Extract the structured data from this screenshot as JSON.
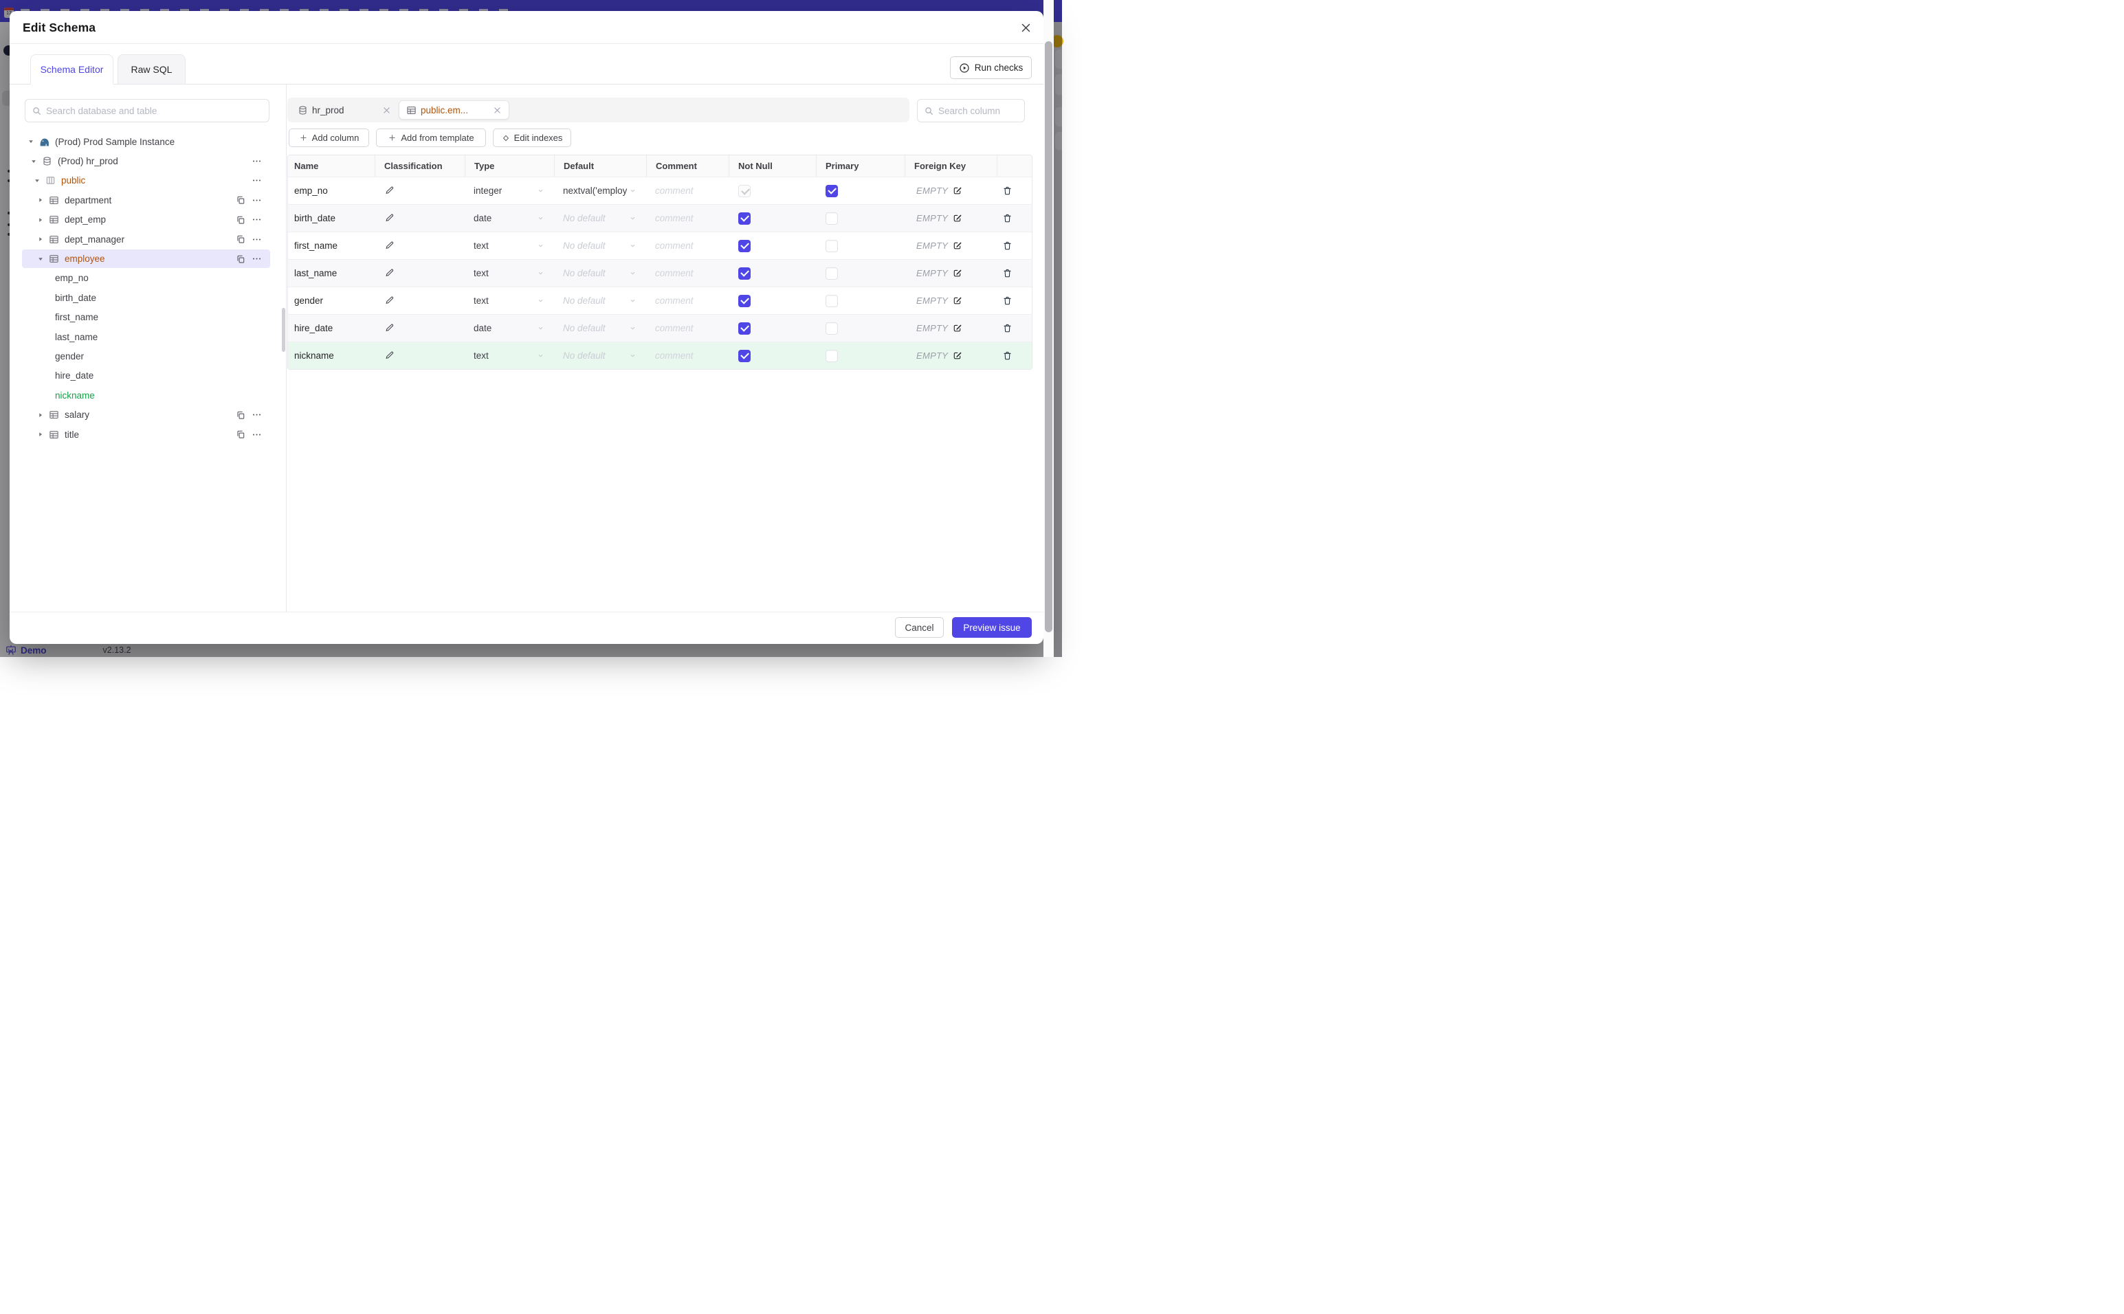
{
  "background": {
    "top_bar_color": "#4f46e5",
    "demo_label": "Demo",
    "version": "v2.13.2"
  },
  "modal": {
    "title": "Edit Schema",
    "tabs": [
      {
        "label": "Schema Editor",
        "active": true
      },
      {
        "label": "Raw SQL",
        "active": false
      }
    ],
    "run_checks_label": "Run checks",
    "sidebar": {
      "search_placeholder": "Search database and table",
      "tree": [
        {
          "label": "(Prod) Prod Sample Instance",
          "level": 0,
          "caret": "down",
          "icon": "instance"
        },
        {
          "label": "(Prod) hr_prod",
          "level": 1,
          "caret": "down",
          "icon": "database",
          "more": true
        },
        {
          "label": "public",
          "level": 2,
          "caret": "down",
          "icon": "schema",
          "color": "amber",
          "more": true
        },
        {
          "label": "department",
          "level": 3,
          "caret": "right",
          "icon": "table",
          "copy": true,
          "more": true
        },
        {
          "label": "dept_emp",
          "level": 3,
          "caret": "right",
          "icon": "table",
          "copy": true,
          "more": true
        },
        {
          "label": "dept_manager",
          "level": 3,
          "caret": "right",
          "icon": "table",
          "copy": true,
          "more": true
        },
        {
          "label": "employee",
          "level": 3,
          "caret": "down",
          "icon": "table",
          "color": "amber",
          "selected": true,
          "copy": true,
          "more": true
        },
        {
          "label": "emp_no",
          "level": 4
        },
        {
          "label": "birth_date",
          "level": 4
        },
        {
          "label": "first_name",
          "level": 4
        },
        {
          "label": "last_name",
          "level": 4
        },
        {
          "label": "gender",
          "level": 4
        },
        {
          "label": "hire_date",
          "level": 4
        },
        {
          "label": "nickname",
          "level": 4,
          "color": "green"
        },
        {
          "label": "salary",
          "level": 3,
          "caret": "right",
          "icon": "table",
          "copy": true,
          "more": true
        },
        {
          "label": "title",
          "level": 3,
          "caret": "right",
          "icon": "table",
          "copy": true,
          "more": true
        }
      ]
    },
    "editor": {
      "chips": [
        {
          "label": "hr_prod",
          "icon": "database",
          "active": false
        },
        {
          "label": "public.em...",
          "icon": "table",
          "active": true
        }
      ],
      "toolbar": [
        {
          "icon": "plus",
          "label": "Add column"
        },
        {
          "icon": "plus",
          "label": "Add from template"
        },
        {
          "icon": "diamond",
          "label": "Edit indexes"
        }
      ],
      "search_placeholder": "Search column",
      "table": {
        "headers": [
          "Name",
          "Classification",
          "Type",
          "Default",
          "Comment",
          "Not Null",
          "Primary",
          "Foreign Key",
          ""
        ],
        "comment_placeholder": "comment",
        "foreign_key_empty": "EMPTY",
        "rows": [
          {
            "name": "emp_no",
            "type": "integer",
            "default": "nextval('employ",
            "default_is_placeholder": false,
            "not_null": "checked-disabled",
            "primary": "checked"
          },
          {
            "name": "birth_date",
            "type": "date",
            "default": "No default",
            "default_is_placeholder": true,
            "not_null": "checked",
            "primary": "unchecked"
          },
          {
            "name": "first_name",
            "type": "text",
            "default": "No default",
            "default_is_placeholder": true,
            "not_null": "checked",
            "primary": "unchecked"
          },
          {
            "name": "last_name",
            "type": "text",
            "default": "No default",
            "default_is_placeholder": true,
            "not_null": "checked",
            "primary": "unchecked"
          },
          {
            "name": "gender",
            "type": "text",
            "default": "No default",
            "default_is_placeholder": true,
            "not_null": "checked",
            "primary": "unchecked"
          },
          {
            "name": "hire_date",
            "type": "date",
            "default": "No default",
            "default_is_placeholder": true,
            "not_null": "checked",
            "primary": "unchecked"
          },
          {
            "name": "nickname",
            "type": "text",
            "default": "No default",
            "default_is_placeholder": true,
            "not_null": "checked",
            "primary": "unchecked",
            "highlight": "green"
          }
        ]
      }
    },
    "footer": {
      "cancel_label": "Cancel",
      "primary_label": "Preview issue"
    }
  },
  "colors": {
    "accent": "#4f46e5",
    "amber_changed": "#b45309",
    "green_new": "#16a34a",
    "selected_row_bg": "#e8e7fc",
    "new_row_bg": "#e9f8ef"
  }
}
